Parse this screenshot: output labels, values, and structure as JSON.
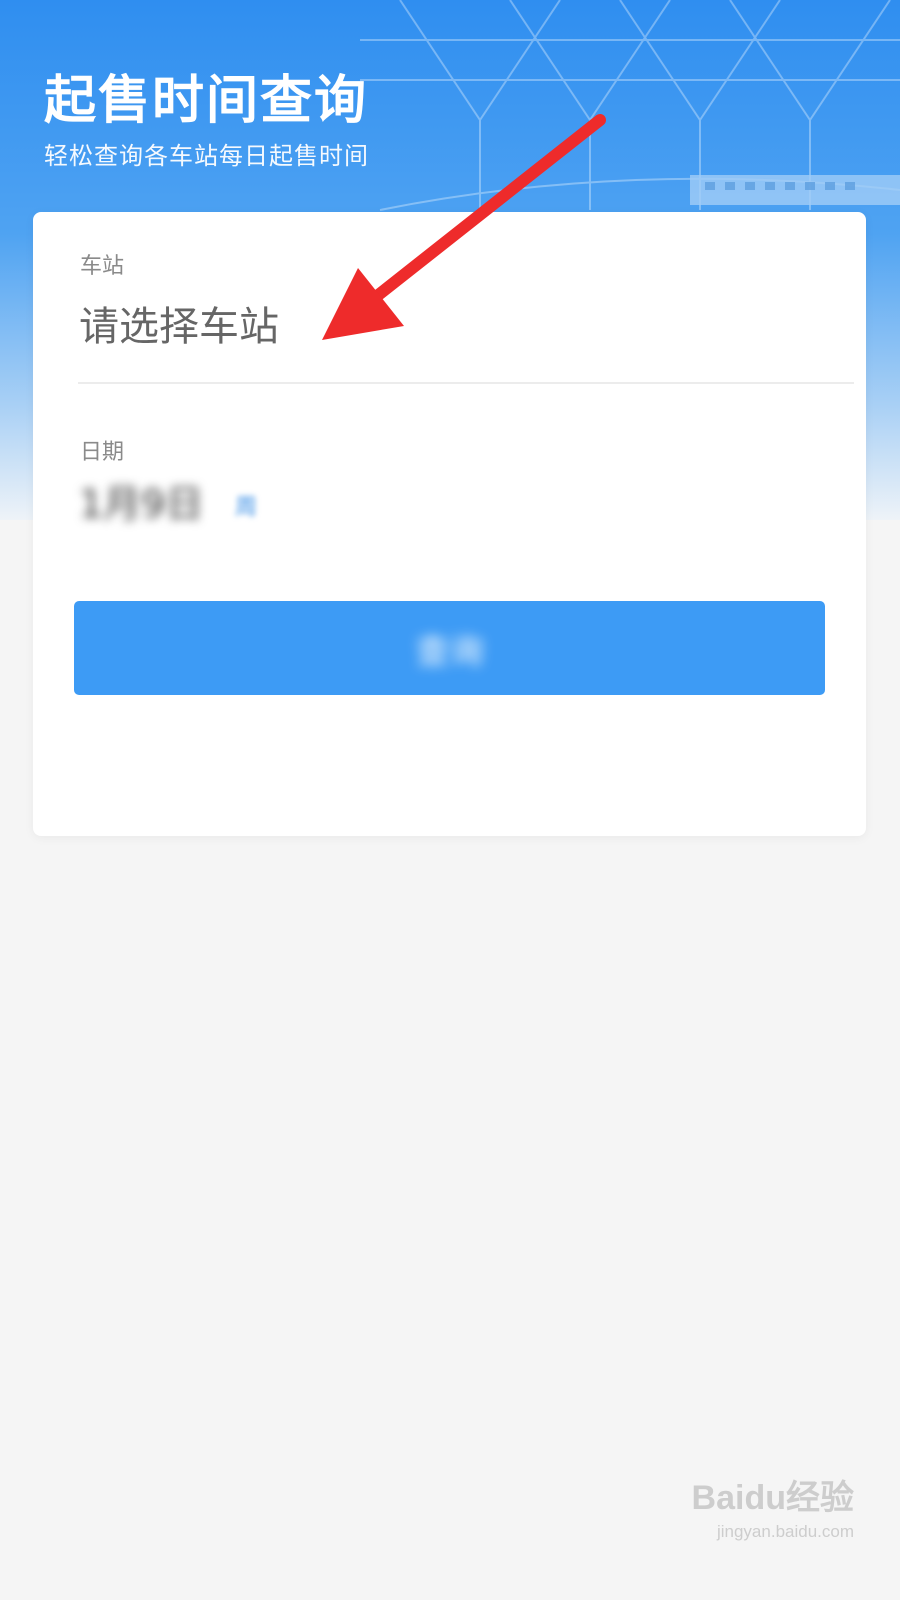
{
  "header": {
    "title": "起售时间查询",
    "subtitle": "轻松查询各车站每日起售时间"
  },
  "form": {
    "station_label": "车站",
    "station_placeholder": "请选择车站",
    "date_label": "日期",
    "date_value": "1月9日",
    "weekday_value": "周",
    "query_button_label": "查询"
  },
  "watermark": {
    "logo": "Baidu经验",
    "url": "jingyan.baidu.com"
  },
  "colors": {
    "accent": "#3d9bf5",
    "annotation_arrow": "#ee2b2b",
    "header_gradient_top": "#2f8ef0"
  },
  "icons": {
    "annotation": "arrow-pointer-icon"
  }
}
